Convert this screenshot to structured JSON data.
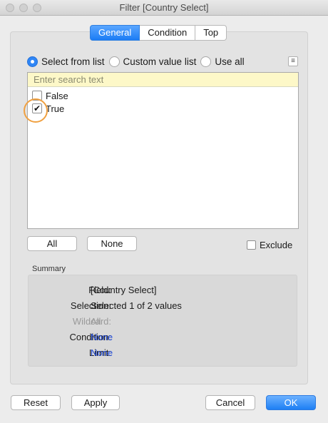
{
  "window": {
    "title": "Filter [Country Select]"
  },
  "tabs": [
    {
      "label": "General",
      "active": true
    },
    {
      "label": "Condition",
      "active": false
    },
    {
      "label": "Top",
      "active": false
    }
  ],
  "mode": {
    "options": [
      {
        "label": "Select from list",
        "selected": true
      },
      {
        "label": "Custom value list",
        "selected": false
      },
      {
        "label": "Use all",
        "selected": false
      }
    ],
    "menu_icon": "list-menu-icon"
  },
  "search": {
    "placeholder": "Enter search text",
    "value": ""
  },
  "values": [
    {
      "label": "False",
      "checked": false
    },
    {
      "label": "True",
      "checked": true
    }
  ],
  "list_buttons": {
    "all": "All",
    "none": "None"
  },
  "exclude": {
    "label": "Exclude",
    "checked": false
  },
  "summary": {
    "title": "Summary",
    "rows": [
      {
        "key": "Field:",
        "value": "[Country Select]"
      },
      {
        "key": "Selection:",
        "value": "Selected 1 of 2 values"
      },
      {
        "key": "Wildcard:",
        "value": "All"
      },
      {
        "key": "Condition:",
        "value": "None"
      },
      {
        "key": "Limit:",
        "value": "None"
      }
    ]
  },
  "footer": {
    "reset": "Reset",
    "apply": "Apply",
    "cancel": "Cancel",
    "ok": "OK"
  },
  "colors": {
    "accent": "#1e7ff4",
    "highlight": "#f0a040",
    "link": "#1e48d8",
    "search_bg": "#fdf8c8"
  }
}
